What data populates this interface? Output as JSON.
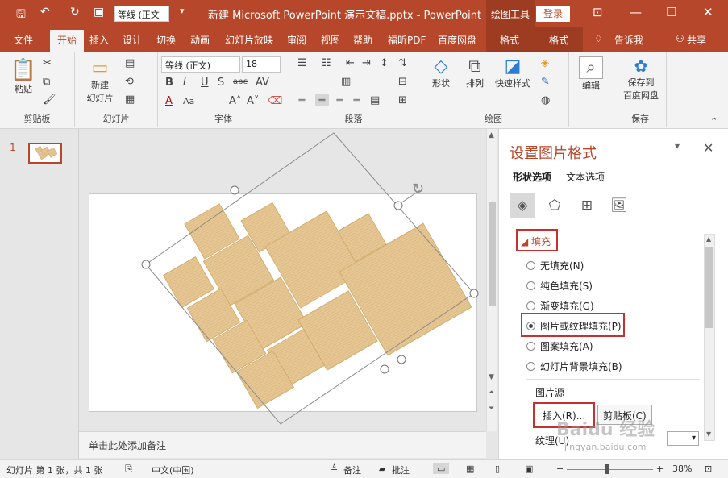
{
  "titlebar": {
    "font_combo": "等线 (正文",
    "doc_title": "新建 Microsoft PowerPoint 演示文稿.pptx  -  PowerPoint",
    "context_label": "绘图工具",
    "login": "登录"
  },
  "tabs": [
    "文件",
    "开始",
    "插入",
    "设计",
    "切换",
    "动画",
    "幻灯片放映",
    "审阅",
    "视图",
    "帮助",
    "福昕PDF",
    "百度网盘",
    "格式",
    "格式",
    "告诉我",
    "共享"
  ],
  "ribbon": {
    "paste": "粘贴",
    "clipboard": "剪贴板",
    "new_slide": "新建",
    "new_slide2": "幻灯片",
    "slides": "幻灯片",
    "font_name": "等线 (正文)",
    "font_size": "18",
    "font": "字体",
    "paragraph": "段落",
    "shape": "形状",
    "arrange": "排列",
    "quick_styles": "快速样式",
    "drawing": "绘图",
    "edit": "编辑",
    "save_to": "保存到",
    "save_to2": "百度网盘",
    "save": "保存"
  },
  "slides_pane": {
    "number": "1"
  },
  "notes": {
    "placeholder": "单击此处添加备注"
  },
  "format_pane": {
    "title": "设置图片格式",
    "tab_shape": "形状选项",
    "tab_text": "文本选项",
    "fill_header": "填充",
    "fill_options": [
      "无填充(N)",
      "纯色填充(S)",
      "渐变填充(G)",
      "图片或纹理填充(P)",
      "图案填充(A)",
      "幻灯片背景填充(B)"
    ],
    "selected_fill": "图片或纹理填充(P)",
    "picture_source": "图片源",
    "insert_btn": "插入(R)...",
    "clipboard_btn": "剪贴板(C)",
    "texture": "纹理(U)"
  },
  "status": {
    "slide_info": "幻灯片 第 1 张，共 1 张",
    "language": "中文(中国)",
    "notes": "备注",
    "comments": "批注",
    "zoom": "38%"
  },
  "watermark": {
    "text": "Baidu 经验",
    "url": "jingyan.baidu.com"
  }
}
